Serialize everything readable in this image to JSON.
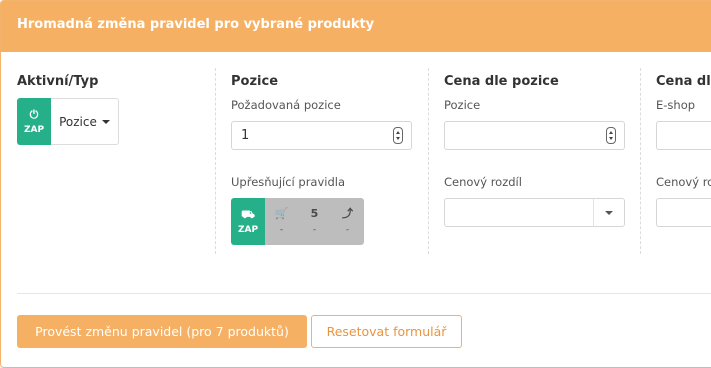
{
  "header": {
    "title": "Hromadná změna pravidel pro vybrané produkty"
  },
  "columns": {
    "active": {
      "title": "Aktivní/Typ",
      "toggle_icon": "power-icon",
      "toggle_glyph": "⏻",
      "toggle_label": "ZAP",
      "type_value": "Pozice"
    },
    "position": {
      "title": "Pozice",
      "desired_label": "Požadovaná pozice",
      "desired_value": "1",
      "rules_label": "Upřesňující pravidla",
      "rules": [
        {
          "icon": "truck-icon",
          "glyph": "⛟",
          "label": "ZAP",
          "active": true
        },
        {
          "icon": "cart-icon",
          "glyph": "🛒",
          "label": "-",
          "active": false
        },
        {
          "icon": "number-five",
          "glyph": "5",
          "label": "-",
          "active": false
        },
        {
          "icon": "arrow-up-icon",
          "glyph": "⤴",
          "label": "-",
          "active": false
        }
      ]
    },
    "price_by_position": {
      "title": "Cena dle pozice",
      "position_label": "Pozice",
      "position_value": "",
      "diff_label": "Cenový rozdíl",
      "diff_value": ""
    },
    "price_by_eshop": {
      "title": "Cena dle",
      "eshop_label": "E-shop",
      "diff_label": "Cenový ro"
    }
  },
  "footer": {
    "apply_label": "Provést změnu pravidel (pro 7 produktů)",
    "reset_label": "Resetovat formulář"
  },
  "colors": {
    "accent": "#f5b064",
    "on": "#26b08a",
    "off": "#bdbdbd"
  }
}
